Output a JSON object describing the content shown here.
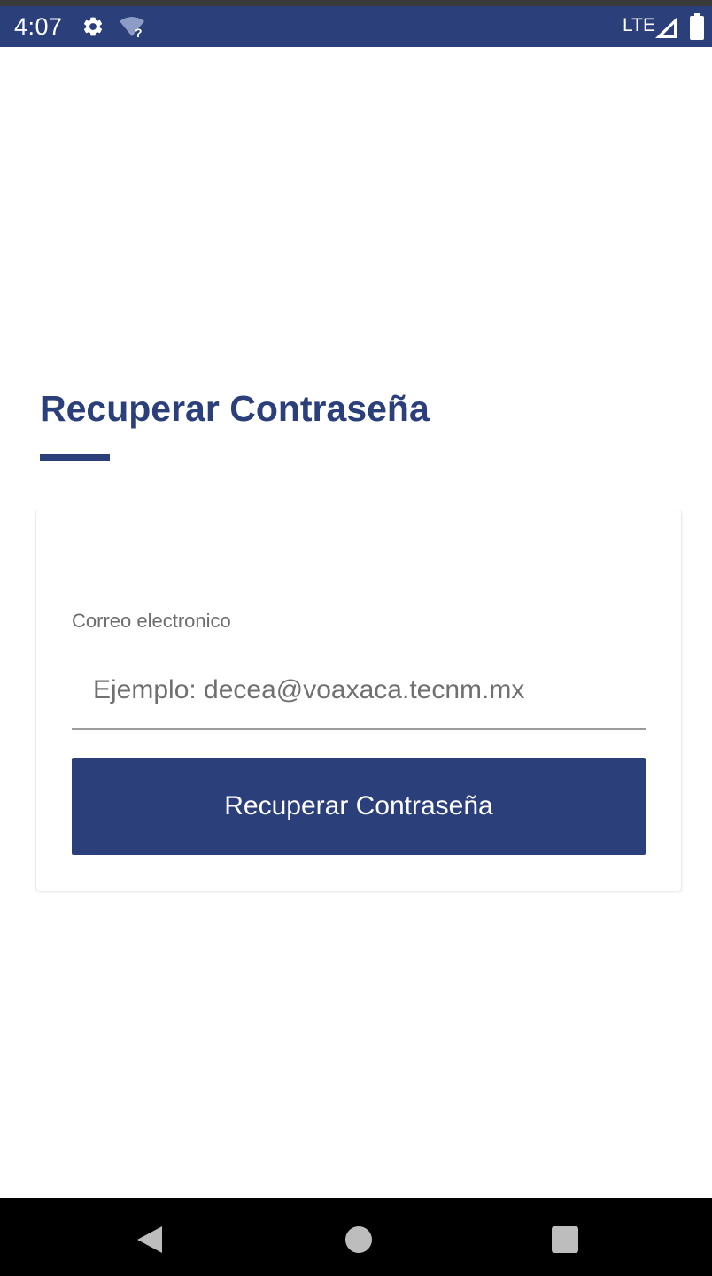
{
  "status_bar": {
    "time": "4:07",
    "network": "LTE",
    "icons": [
      "gear-icon",
      "wifi-unknown-icon",
      "signal-icon",
      "battery-icon"
    ]
  },
  "page": {
    "title": "Recuperar Contraseña"
  },
  "form": {
    "email_label": "Correo electronico",
    "email_placeholder": "Ejemplo: decea@voaxaca.tecnm.mx",
    "email_value": "",
    "submit_label": "Recuperar Contraseña"
  },
  "nav_bar": {
    "buttons": [
      "back-icon",
      "home-icon",
      "recents-icon"
    ]
  },
  "colors": {
    "primary": "#2b3f7a",
    "label_gray": "#6e6e6e",
    "underline_gray": "#9c9c9c"
  }
}
